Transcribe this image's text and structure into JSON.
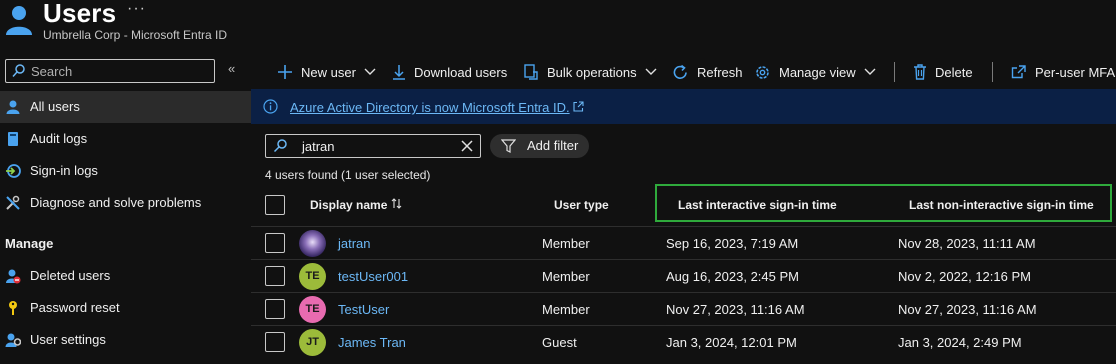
{
  "header": {
    "title": "Users",
    "more": "···",
    "subtitle": "Umbrella Corp - Microsoft Entra ID"
  },
  "sidebar": {
    "search_placeholder": "Search",
    "collapse": "«",
    "items": [
      {
        "label": "All users",
        "icon": "user-icon"
      },
      {
        "label": "Audit logs",
        "icon": "book-icon"
      },
      {
        "label": "Sign-in logs",
        "icon": "signin-icon"
      },
      {
        "label": "Diagnose and solve problems",
        "icon": "wrench-icon"
      }
    ],
    "section": "Manage",
    "manage_items": [
      {
        "label": "Deleted users",
        "icon": "deleted-user-icon"
      },
      {
        "label": "Password reset",
        "icon": "key-icon"
      },
      {
        "label": "User settings",
        "icon": "user-settings-icon"
      }
    ]
  },
  "toolbar": {
    "new_user": "New user",
    "download_users": "Download users",
    "bulk_operations": "Bulk operations",
    "refresh": "Refresh",
    "manage_view": "Manage view",
    "delete": "Delete",
    "per_user_mfa": "Per-user MFA"
  },
  "banner": {
    "text": "Azure Active Directory is now Microsoft Entra ID."
  },
  "filter": {
    "search_value": "jatran",
    "add_filter": "Add filter"
  },
  "results": {
    "count_text": "4 users found (1 user selected)"
  },
  "table": {
    "headers": {
      "display_name": "Display name",
      "user_type": "User type",
      "last_interactive": "Last interactive sign-in time",
      "last_non_interactive": "Last non-interactive sign-in time"
    },
    "rows": [
      {
        "initials": "",
        "name": "jatran",
        "type": "Member",
        "last": "Sep 16, 2023, 7:19 AM",
        "nonint": "Nov 28, 2023, 11:11 AM"
      },
      {
        "initials": "TE",
        "name": "testUser001",
        "type": "Member",
        "last": "Aug 16, 2023, 2:45 PM",
        "nonint": "Nov 2, 2022, 12:16 PM"
      },
      {
        "initials": "TE",
        "name": "TestUser",
        "type": "Member",
        "last": "Nov 27, 2023, 11:16 AM",
        "nonint": "Nov 27, 2023, 11:16 AM"
      },
      {
        "initials": "JT",
        "name": "James Tran",
        "type": "Guest",
        "last": "Jan 3, 2024, 12:01 PM",
        "nonint": "Jan 3, 2024, 2:49 PM"
      }
    ]
  },
  "colors": {
    "accent": "#4aa3ef",
    "link": "#6cb8f6",
    "banner_bg": "#0b2045",
    "highlight_border": "#2faa3c",
    "avatar_green": "#9cbb3a",
    "avatar_pink": "#e86bb0"
  }
}
